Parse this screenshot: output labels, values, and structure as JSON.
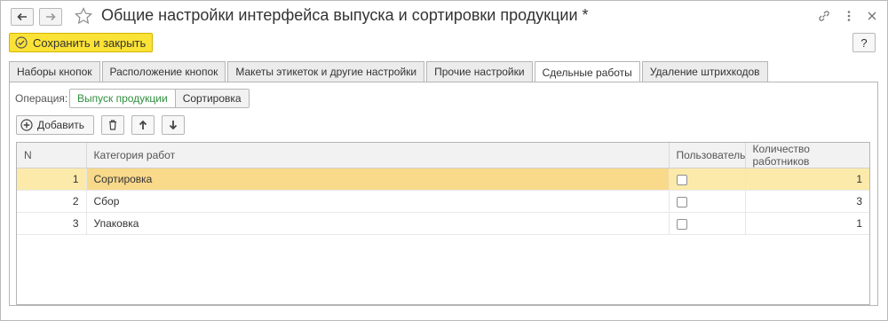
{
  "window": {
    "title": "Общие настройки интерфейса выпуска и сортировки продукции *"
  },
  "toolbar": {
    "save_label": "Сохранить и закрыть",
    "help_label": "?"
  },
  "tabs": [
    {
      "label": "Наборы кнопок",
      "active": false
    },
    {
      "label": "Расположение кнопок",
      "active": false
    },
    {
      "label": "Макеты этикеток и другие настройки",
      "active": false
    },
    {
      "label": "Прочие настройки",
      "active": false
    },
    {
      "label": "Сдельные работы",
      "active": true
    },
    {
      "label": "Удаление штрихкодов",
      "active": false
    }
  ],
  "operation": {
    "label": "Операция:",
    "options": [
      "Выпуск продукции",
      "Сортировка"
    ],
    "selected": "Выпуск продукции"
  },
  "commands": {
    "add_label": "Добавить"
  },
  "table": {
    "columns": [
      "N",
      "Категория работ",
      "Пользователь",
      "Количество работников"
    ],
    "rows": [
      {
        "n": "1",
        "category": "Сортировка",
        "user": false,
        "workers": "1",
        "selected": true
      },
      {
        "n": "2",
        "category": "Сбор",
        "user": false,
        "workers": "3",
        "selected": false
      },
      {
        "n": "3",
        "category": "Упаковка",
        "user": false,
        "workers": "1",
        "selected": false
      }
    ]
  },
  "colors": {
    "accent_save": "#fbe236",
    "selected_row": "#fbeaaa",
    "active_option": "#2f8f3e"
  }
}
